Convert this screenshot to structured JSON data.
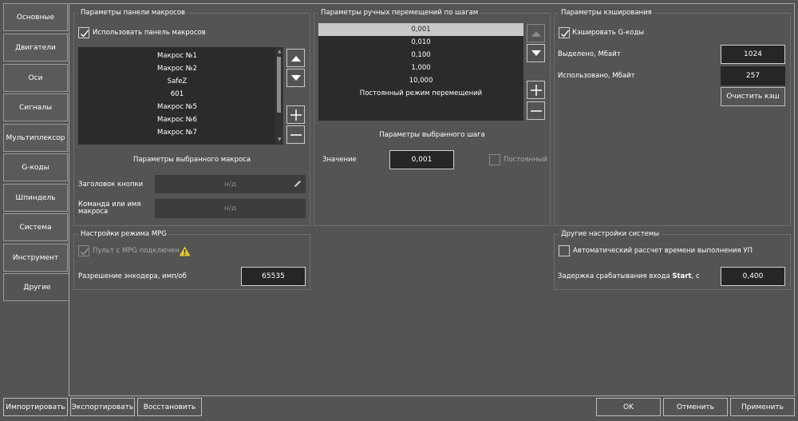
{
  "tabs": [
    "Основные",
    "Двигатели",
    "Оси",
    "Сигналы",
    "Мультиплексор",
    "G-коды",
    "Шпиндель",
    "Система",
    "Инструмент",
    "Другие"
  ],
  "macro_panel": {
    "title": "Параметры панели макросов",
    "use_checkbox_label": "Использовать панель макросов",
    "use_checked": true,
    "items": [
      "Макрос №1",
      "Макрос №2",
      "SafeZ",
      "601",
      "Макрос №5",
      "Макрос №6",
      "Макрос №7"
    ],
    "selected_title": "Параметры выбранного макроса",
    "button_caption_label": "Заголовок кнопки",
    "button_caption_placeholder": "н/д",
    "command_label": "Команда или имя макроса",
    "command_placeholder": "н/д"
  },
  "jog_panel": {
    "title": "Параметры ручных перемещений по шагам",
    "steps": [
      "0,001",
      "0,010",
      "0,100",
      "1,000",
      "10,000",
      "Постоянный режим перемещений"
    ],
    "selected_index": 0,
    "selected_title": "Параметры выбранного шага",
    "value_label": "Значение",
    "value": "0,001",
    "constant_label": "Постоянный"
  },
  "cache_panel": {
    "title": "Параметры кэширования",
    "cache_label": "Кэшировать G-коды",
    "cache_checked": true,
    "allocated_label": "Выделено, Мбайт",
    "allocated_value": "1024",
    "used_label": "Использовано, Мбайт",
    "used_value": "257",
    "clear_button": "Очистить кэш"
  },
  "mpg_panel": {
    "title": "Настройки режима MPG",
    "connected_label": "Пульт с MPG подключен",
    "resolution_label": "Разрешение энкодера, имп/об",
    "resolution_value": "65535"
  },
  "other_panel": {
    "title": "Другие настройки системы",
    "auto_calc_label": "Автоматический рассчет времени выполнения УП",
    "delay_label_main": "Задержка срабатывания входа ",
    "delay_label_bold": "Start",
    "delay_label_tail": ", с",
    "delay_value": "0,400"
  },
  "footer": {
    "import": "Импортировать",
    "export": "Экспортировать",
    "restore": "Восстановить",
    "ok": "OK",
    "cancel": "Отменить",
    "apply": "Применить"
  },
  "colors": {
    "background": "#545454",
    "list_background": "#2b2b2b",
    "selected_row": "#c8c8c8",
    "warning": "#e6c82e"
  }
}
